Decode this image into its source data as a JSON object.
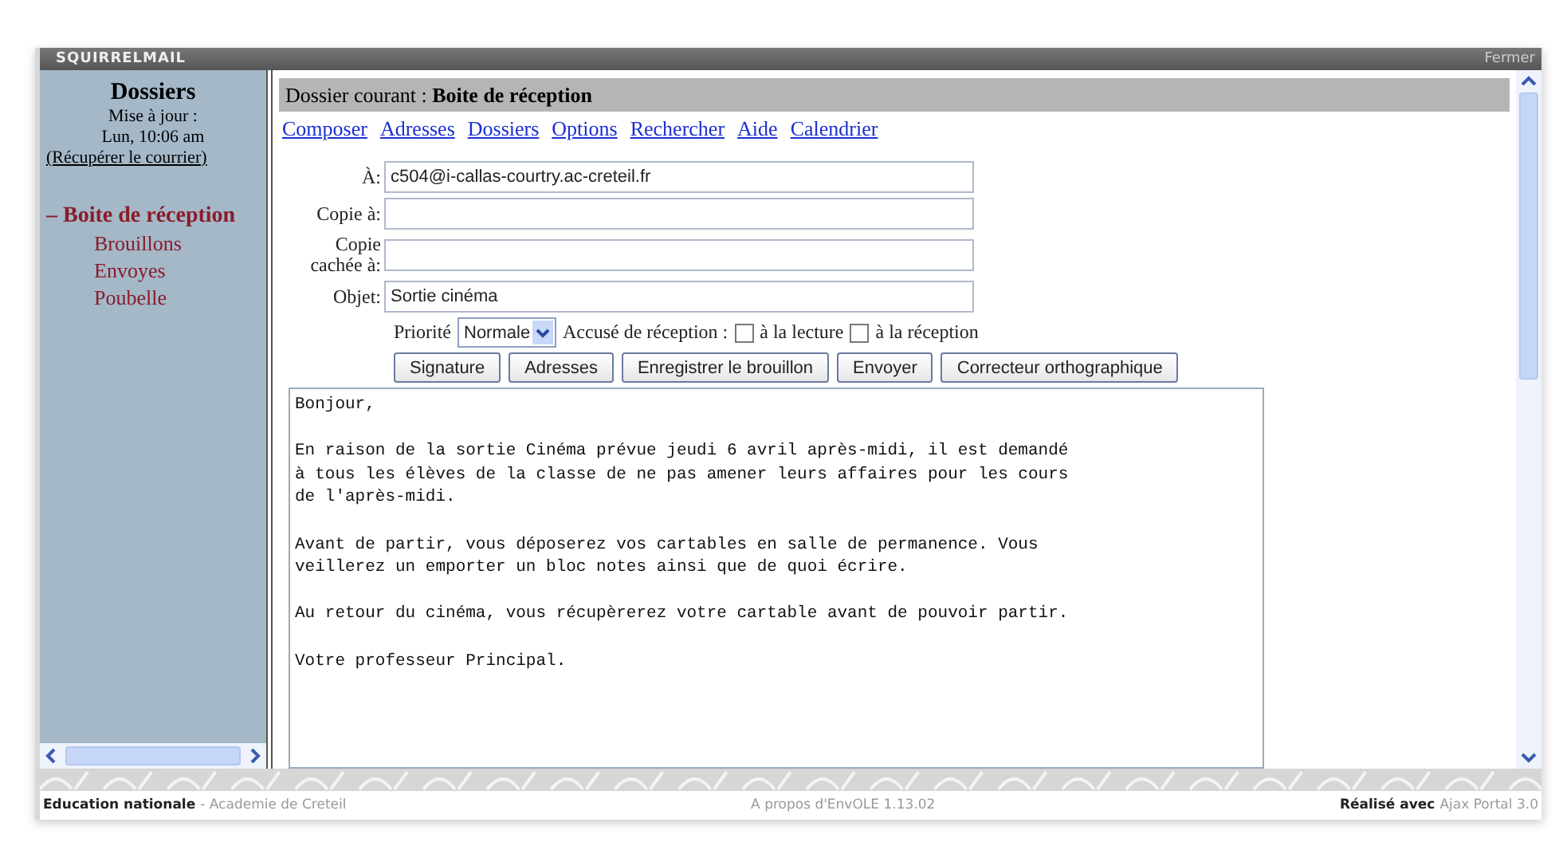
{
  "header": {
    "brand": "SQUIRRELMAIL",
    "close": "Fermer"
  },
  "sidebar": {
    "title": "Dossiers",
    "updated_label": "Mise à jour :",
    "updated_time": "Lun, 10:06 am",
    "fetch_link": "(Récupérer le courrier)",
    "folders": [
      {
        "label": "Boite de réception",
        "selected": true,
        "marker": "–"
      },
      {
        "label": "Brouillons",
        "selected": false
      },
      {
        "label": "Envoyes",
        "selected": false
      },
      {
        "label": "Poubelle",
        "selected": false
      }
    ]
  },
  "current_folder": "Dossier courant : **Boite de réception**",
  "menu": [
    "Composer",
    "Adresses",
    "Dossiers",
    "Options",
    "Rechercher",
    "Aide",
    "Calendrier"
  ],
  "fields": [
    {
      "label": "À:",
      "value": "c504@i-callas-courtry.ac-creteil.fr"
    },
    {
      "label": "Copie à:"
    },
    {
      "label": "Copie cachée à:"
    },
    {
      "label": "Objet:",
      "value": "Sortie cinéma"
    }
  ],
  "priority": {
    "label": "Priorité",
    "value": "Normale"
  },
  "receipt": {
    "label": "Accusé de réception :",
    "options": [
      {
        "label": "à la lecture",
        "checked": false
      },
      {
        "label": "à la réception",
        "checked": false
      }
    ]
  },
  "buttons": [
    "Signature",
    "Adresses",
    "Enregistrer le brouillon",
    "Envoyer",
    "Correcteur orthographique"
  ],
  "body": "Bonjour,\n\nEn raison de la sortie Cinéma prévue jeudi 6 avril après-midi, il est demandé\nà tous les élèves de la classe de ne pas amener leurs affaires pour les cours\nde l'après-midi.\n\nAvant de partir, vous déposerez vos cartables en salle de permanence. Vous\nveillerez un emporter un bloc notes ainsi que de quoi écrire.\n\nAu retour du cinéma, vous récupèrerez votre cartable avant de pouvoir partir.\n\nVotre professeur Principal.",
  "footer": {
    "org": "Education nationale",
    "org_sub": "- Academie de Creteil",
    "about": "A propos d'EnvOLE 1.13.02",
    "made_label": "Réalisé avec",
    "made_by": "Ajax Portal 3.0"
  }
}
